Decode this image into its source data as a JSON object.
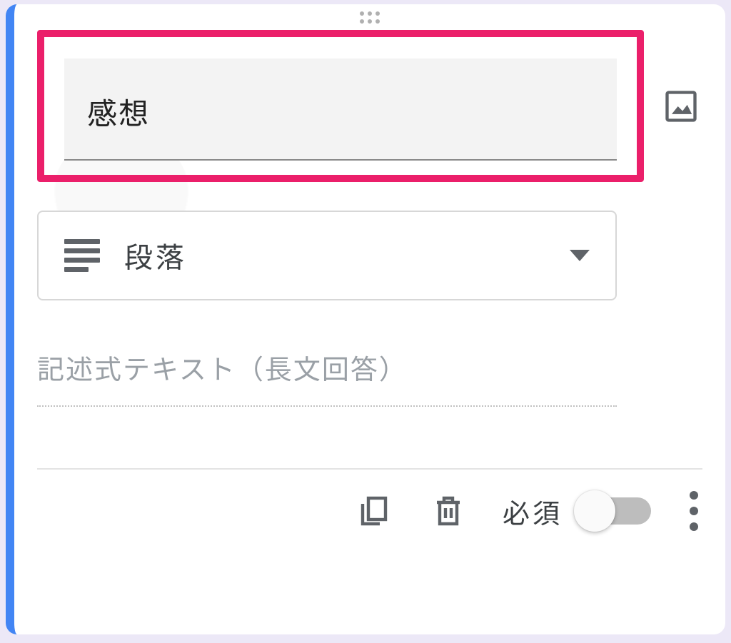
{
  "question": {
    "title": "感想"
  },
  "questionType": {
    "label": "段落"
  },
  "answerPreview": {
    "placeholder": "記述式テキスト（長文回答）"
  },
  "footer": {
    "requiredLabel": "必須",
    "required": false
  }
}
